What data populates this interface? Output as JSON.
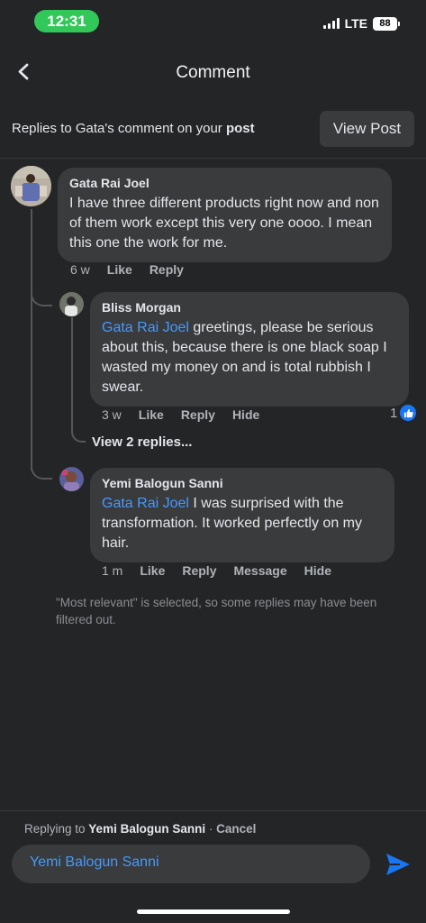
{
  "status_bar": {
    "time": "12:31",
    "network": "LTE",
    "battery": "88"
  },
  "header": {
    "title": "Comment",
    "back_icon": "chevron-left-icon"
  },
  "replies_bar": {
    "prefix": "Replies to Gata's comment on your ",
    "bold": "post",
    "view_post_label": "View Post"
  },
  "comments": [
    {
      "author": "Gata Rai Joel",
      "mention": "",
      "text": "I have three different products right now and non of them work except this very one oooo. I mean this one the work for me.",
      "time": "6 w",
      "actions": [
        "Like",
        "Reply"
      ]
    },
    {
      "author": "Bliss Morgan",
      "mention": "Gata Rai Joel",
      "text": " greetings, please be serious about this, because there is one black soap I wasted my money on and is total rubbish I swear.",
      "time": "3 w",
      "actions": [
        "Like",
        "Reply",
        "Hide"
      ],
      "likes": "1"
    },
    {
      "author": "Yemi Balogun Sanni",
      "mention": "Gata Rai Joel",
      "text": " I was surprised with the transformation. It worked perfectly on my hair.",
      "time": "1 m",
      "actions": [
        "Like",
        "Reply",
        "Message",
        "Hide"
      ]
    }
  ],
  "view_replies": "View 2 replies...",
  "filter_note": "\"Most relevant\" is selected, so some replies may have been filtered out.",
  "composer": {
    "replying_prefix": "Replying to ",
    "replying_name": "Yemi Balogun Sanni",
    "separator": " · ",
    "cancel": "Cancel",
    "input_value": "Yemi Balogun Sanni",
    "send_icon": "send-icon"
  },
  "colors": {
    "background": "#242526",
    "bubble": "#3a3b3c",
    "mention": "#4599ff",
    "like_badge": "#1877f2",
    "time_pill": "#32c759"
  }
}
